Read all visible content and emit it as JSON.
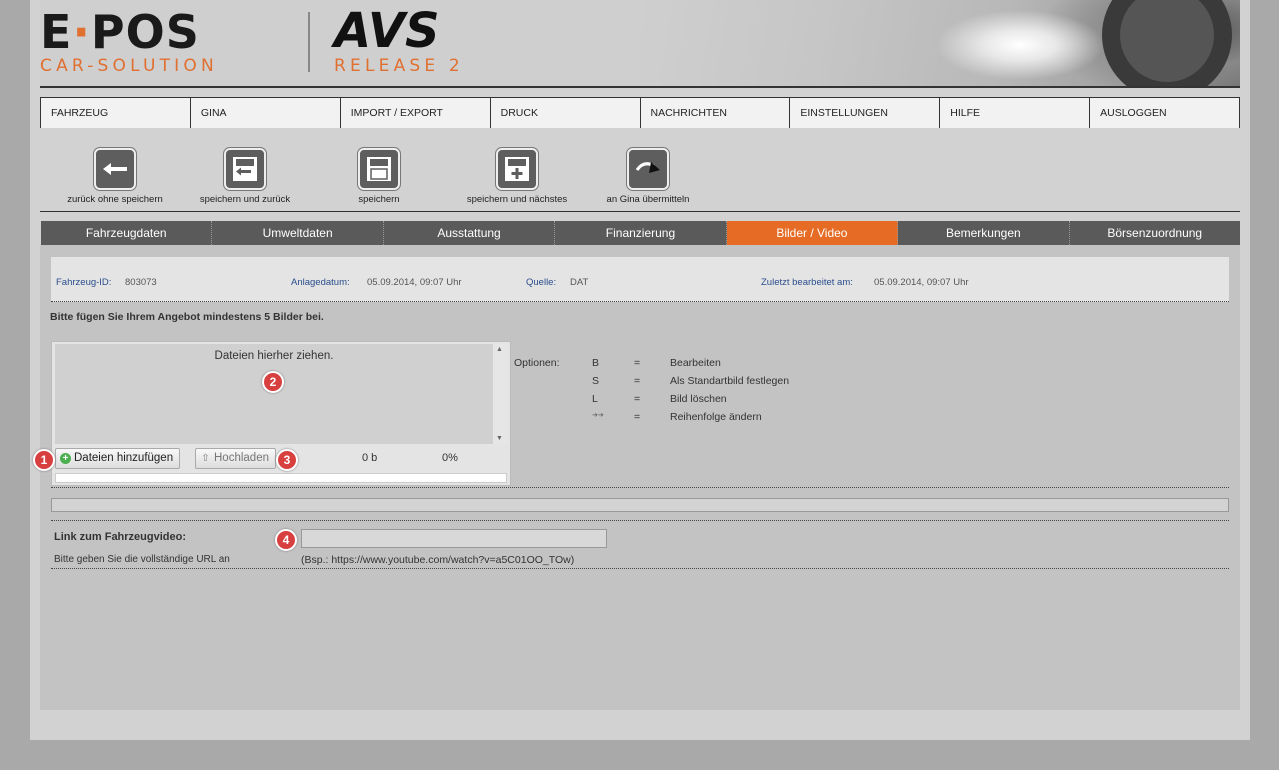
{
  "header": {
    "brand_main": "E",
    "brand_dot": "·",
    "brand_rest": "POS",
    "brand_sub": "CAR-SOLUTION",
    "product": "AVS",
    "release": "RELEASE 2"
  },
  "menu": [
    "FAHRZEUG",
    "GINA",
    "IMPORT / EXPORT",
    "DRUCK",
    "NACHRICHTEN",
    "EINSTELLUNGEN",
    "HILFE",
    "AUSLOGGEN"
  ],
  "toolbar": {
    "back": "zurück ohne speichern",
    "save_back": "speichern und zurück",
    "save": "speichern",
    "save_next": "speichern und nächstes",
    "send_gina": "an Gina übermitteln"
  },
  "tabs": [
    "Fahrzeugdaten",
    "Umweltdaten",
    "Ausstattung",
    "Finanzierung",
    "Bilder / Video",
    "Bemerkungen",
    "Börsenzuordnung"
  ],
  "active_tab": "Bilder / Video",
  "info": {
    "id_label": "Fahrzeug-ID:",
    "id_value": "803073",
    "created_label": "Anlagedatum:",
    "created_value": "05.09.2014, 09:07 Uhr",
    "source_label": "Quelle:",
    "source_value": "DAT",
    "edited_label": "Zuletzt bearbeitet am:",
    "edited_value": "05.09.2014, 09:07 Uhr"
  },
  "hint": "Bitte fügen Sie Ihrem Angebot mindestens 5 Bilder bei.",
  "uploader": {
    "drop_text": "Dateien hierher ziehen.",
    "add_files": "Dateien hinzufügen",
    "upload": "Hochladen",
    "size": "0 b",
    "percent": "0%",
    "progress": 0
  },
  "options": {
    "label": "Optionen:",
    "rows": [
      {
        "key": "B",
        "eq": "=",
        "desc": "Bearbeiten"
      },
      {
        "key": "S",
        "eq": "=",
        "desc": "Als Standartbild festlegen"
      },
      {
        "key": "L",
        "eq": "=",
        "desc": "Bild löschen"
      },
      {
        "key": "➔➔",
        "eq": "=",
        "desc": "Reihenfolge ändern"
      }
    ]
  },
  "video": {
    "label": "Link zum Fahrzeugvideo:",
    "hint": "Bitte geben Sie die vollständige URL an",
    "example": "(Bsp.: https://www.youtube.com/watch?v=a5C01OO_TOw)",
    "value": ""
  },
  "badges": [
    "1",
    "2",
    "3",
    "4"
  ],
  "colors": {
    "accent": "#e66b25",
    "tab_bg": "#5a5a5a",
    "badge": "#d84040"
  }
}
